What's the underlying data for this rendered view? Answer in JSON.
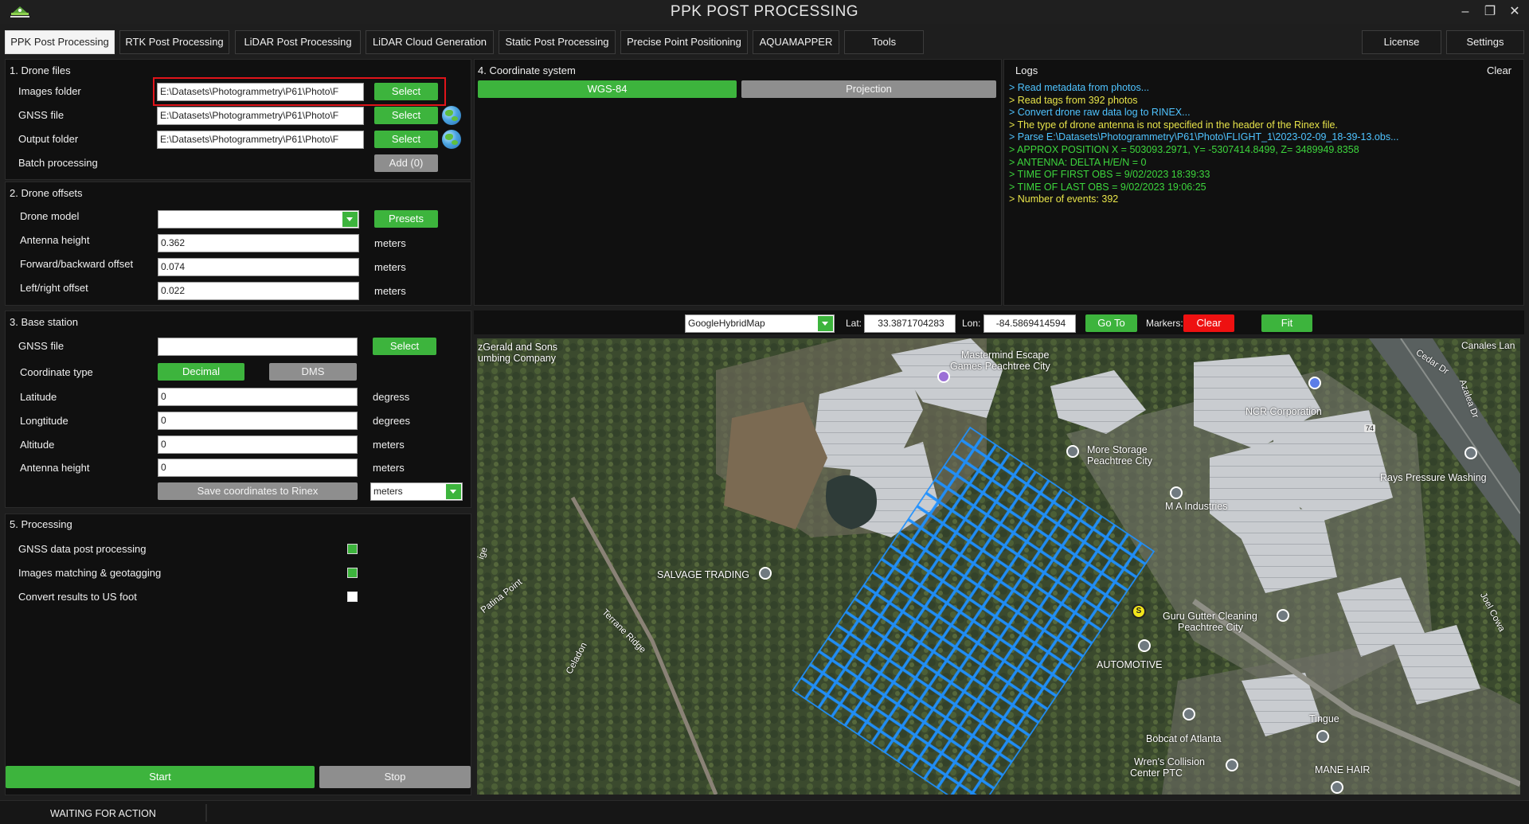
{
  "window": {
    "title": "PPK POST PROCESSING",
    "minimize": "–",
    "restore": "❐",
    "close": "✕"
  },
  "tabs": [
    {
      "label": "PPK Post Processing",
      "active": true
    },
    {
      "label": "RTK Post Processing"
    },
    {
      "label": "LiDAR Post Processing"
    },
    {
      "label": "LiDAR Cloud Generation"
    },
    {
      "label": "Static Post Processing"
    },
    {
      "label": "Precise Point Positioning"
    },
    {
      "label": "AQUAMAPPER"
    },
    {
      "label": "Tools"
    },
    {
      "label": "License"
    },
    {
      "label": "Settings"
    }
  ],
  "drone_files": {
    "title": "1. Drone files",
    "images_folder_label": "Images folder",
    "images_folder_value": "E:\\Datasets\\Photogrammetry\\P61\\Photo\\F",
    "gnss_file_label": "GNSS file",
    "gnss_file_value": "E:\\Datasets\\Photogrammetry\\P61\\Photo\\F",
    "output_folder_label": "Output folder",
    "output_folder_value": "E:\\Datasets\\Photogrammetry\\P61\\Photo\\F",
    "batch_label": "Batch processing",
    "select_label": "Select",
    "add_label": "Add (0)"
  },
  "drone_offsets": {
    "title": "2. Drone offsets",
    "model_label": "Drone model",
    "model_value": "",
    "presets_label": "Presets",
    "antenna_height_label": "Antenna height",
    "antenna_height_value": "0.362",
    "forward_label": "Forward/backward offset",
    "forward_value": "0.074",
    "leftright_label": "Left/right offset",
    "leftright_value": "0.022",
    "unit": "meters"
  },
  "base_station": {
    "title": "3. Base station",
    "gnss_file_label": "GNSS file",
    "gnss_file_value": "",
    "select_label": "Select",
    "coord_type_label": "Coordinate type",
    "decimal_label": "Decimal",
    "dms_label": "DMS",
    "latitude_label": "Latitude",
    "latitude_value": "0",
    "latitude_unit": "degress",
    "longitude_label": "Longtitude",
    "longitude_value": "0",
    "longitude_unit": "degrees",
    "altitude_label": "Altitude",
    "altitude_value": "0",
    "altitude_unit": "meters",
    "antenna_height_label": "Antenna height",
    "antenna_height_value": "0",
    "antenna_height_unit": "meters",
    "save_label": "Save coordinates to Rinex",
    "unit_select_value": "meters"
  },
  "coordinate_system": {
    "title": "4. Coordinate system",
    "wgs_label": "WGS-84",
    "projection_label": "Projection"
  },
  "processing": {
    "title": "5. Processing",
    "gnss_label": "GNSS data post processing",
    "gnss_checked": true,
    "images_label": "Images matching & geotagging",
    "images_checked": true,
    "usfoot_label": "Convert results to US foot",
    "usfoot_checked": false,
    "start_label": "Start",
    "stop_label": "Stop"
  },
  "logs": {
    "title": "Logs",
    "clear_label": "Clear",
    "lines": [
      {
        "text": "> Read metadata from photos...",
        "color": "#4fc3ff"
      },
      {
        "text": "> Read tags from 392 photos",
        "color": "#e8e44a"
      },
      {
        "text": "> Convert drone raw data log to RINEX...",
        "color": "#4fc3ff"
      },
      {
        "text": "> The type of drone antenna is not specified in the header of the Rinex file.",
        "color": "#e8e44a"
      },
      {
        "text": "> Parse E:\\Datasets\\Photogrammetry\\P61\\Photo\\FLIGHT_1\\2023-02-09_18-39-13.obs...",
        "color": "#4fc3ff"
      },
      {
        "text": "> APPROX POSITION X = 503093.2971, Y= -5307414.8499, Z= 3489949.8358",
        "color": "#3dd63d"
      },
      {
        "text": "> ANTENNA: DELTA H/E/N = 0",
        "color": "#3dd63d"
      },
      {
        "text": "> TIME OF FIRST OBS = 9/02/2023 18:39:33",
        "color": "#3dd63d"
      },
      {
        "text": "> TIME OF LAST OBS = 9/02/2023 19:06:25",
        "color": "#3dd63d"
      },
      {
        "text": "> Number of events: 392",
        "color": "#e8e44a"
      }
    ]
  },
  "map": {
    "provider_value": "GoogleHybridMap",
    "lat_label": "Lat:",
    "lat_value": "33.3871704283",
    "lon_label": "Lon:",
    "lon_value": "-84.5869414594",
    "goto_label": "Go To",
    "markers_label": "Markers:",
    "clear_label": "Clear",
    "fit_label": "Fit",
    "places": [
      "zGerald and Sons",
      "umbing Company",
      "Mastermind Escape",
      "Games Peachtree City",
      "NCR Corporation",
      "More Storage",
      "Peachtree City",
      "Rays Pressure Washing",
      "M A Industries",
      "SALVAGE TRADING",
      "Guru Gutter Cleaning",
      "Peachtree City",
      "AUTOMOTIVE",
      "Tingue",
      "Bobcat of Atlanta",
      "Wren's Collision",
      "Center PTC",
      "MANE HAIR"
    ],
    "roads": [
      "Canales Lan",
      "Cedar Dr",
      "Azalea Dr",
      "Patina Point",
      "Terrane Ridge",
      "Celadon",
      "Joel Cowa",
      "ige",
      "74"
    ],
    "marker_letter": "S"
  },
  "status": {
    "text": "WAITING FOR ACTION"
  }
}
